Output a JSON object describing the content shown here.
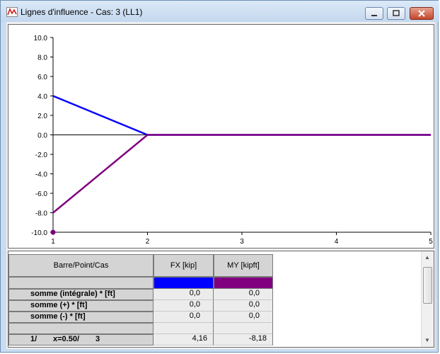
{
  "window": {
    "title": "Lignes d'influence - Cas: 3 (LL1)",
    "buttons": [
      "minimize",
      "maximize",
      "close"
    ]
  },
  "chart_data": {
    "type": "line",
    "title": "",
    "xlabel": "",
    "ylabel": "",
    "xlim": [
      1,
      5
    ],
    "ylim": [
      -10,
      10
    ],
    "x_ticks": [
      "1",
      "2",
      "3",
      "4",
      "5"
    ],
    "y_ticks": [
      "10.0",
      "8.0",
      "6.0",
      "4.0",
      "2.0",
      "0.0",
      "-2.0",
      "-4.0",
      "-6.0",
      "-8.0",
      "-10.0"
    ],
    "series": [
      {
        "color": "#0000ff",
        "points": [
          [
            1,
            4.0
          ],
          [
            2,
            0.0
          ],
          [
            5,
            0.0
          ]
        ]
      },
      {
        "color": "#800080",
        "points": [
          [
            1,
            -8.0
          ],
          [
            2,
            0.0
          ],
          [
            5,
            0.0
          ]
        ]
      }
    ],
    "marker": {
      "x": 1,
      "y": -10,
      "color": "#800080"
    }
  },
  "table": {
    "header": {
      "label": "Barre/Point/Cas",
      "col1": "FX [kip]",
      "col2": "MY [kipft]"
    },
    "colors": {
      "col1": "#0000ff",
      "col2": "#800080"
    },
    "rows": [
      {
        "label": "somme (intégrale) * [ft]",
        "v1": "0,0",
        "v2": "0,0"
      },
      {
        "label": "somme (+) * [ft]",
        "v1": "0,0",
        "v2": "0,0"
      },
      {
        "label": "somme (-) * [ft]",
        "v1": "0,0",
        "v2": "0,0"
      }
    ],
    "data_row": {
      "bar": "1/",
      "x": "x=0.50/",
      "case": "3",
      "v1": "4,16",
      "v2": "-8,18"
    }
  }
}
